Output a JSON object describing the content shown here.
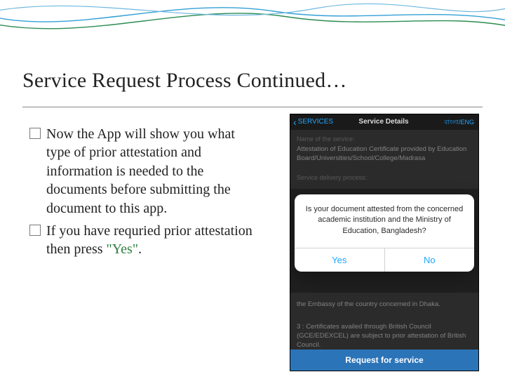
{
  "slide": {
    "title": "Service Request Process Continued…",
    "bullets": [
      "Now the App will show you what type of prior attestation and information is needed to the documents before submitting the document to this app.",
      "If you have requried prior attestation then press "
    ],
    "yes_word": "\"Yes\"",
    "period": "."
  },
  "phone": {
    "back": "SERVICES",
    "title": "Service Details",
    "lang": "বাংলা/ENG",
    "name_label": "Name of the service:",
    "name_body": "Attestation of Education Certificate provided by Education Board/Universities/School/College/Madrasa",
    "proc_label": "Service delivery process:",
    "sheet_q": "Is your document attested from the concerned academic institution and the Ministry of Education, Bangladesh?",
    "yes": "Yes",
    "no": "No",
    "lower1": "the Embassy of the country concerned in Dhaka.",
    "lower2": "3 : Certificates availed through British Council (GCE/EDEXCEL) are subject to prior attestation of British Council.",
    "cta": "Request for service"
  }
}
